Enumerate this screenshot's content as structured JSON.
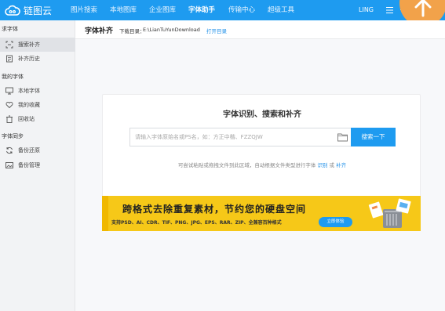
{
  "app": {
    "name": "链图云"
  },
  "nav": {
    "items": [
      {
        "label": "图片搜索"
      },
      {
        "label": "本地图库"
      },
      {
        "label": "企业图库"
      },
      {
        "label": "字体助手"
      },
      {
        "label": "传输中心"
      },
      {
        "label": "超级工具"
      }
    ],
    "active": "字体助手",
    "user": "LING"
  },
  "sidebar": {
    "groups": [
      {
        "title": "求字体",
        "items": [
          {
            "label": "搜索补齐",
            "icon": "scan-icon"
          },
          {
            "label": "补齐历史",
            "icon": "history-icon"
          }
        ]
      },
      {
        "title": "我的字体",
        "items": [
          {
            "label": "本地字体",
            "icon": "monitor-icon"
          },
          {
            "label": "我的收藏",
            "icon": "heart-icon"
          },
          {
            "label": "回收站",
            "icon": "trash-icon"
          }
        ]
      },
      {
        "title": "字体同步",
        "items": [
          {
            "label": "备份还原",
            "icon": "sync-icon"
          },
          {
            "label": "备份管理",
            "icon": "image-icon"
          }
        ]
      }
    ]
  },
  "header": {
    "title": "字体补齐",
    "download_label": "下载目录：",
    "download_path": "E:\\LianTuYunDownload",
    "open_dir": "打开目录"
  },
  "card": {
    "title": "字体识别、搜索和补齐",
    "search_placeholder": "请输入字体原始名或PS名，如：方正中楷、FZZQJW",
    "search_button": "搜索一下",
    "hint_prefix": "可尝试粘贴或拖拽文件到此区域，自动根据文件类型进行字体",
    "hint_link1": "识别",
    "hint_mid": "或",
    "hint_link2": "补齐"
  },
  "banner": {
    "title": "跨格式去除重复素材，节约您的硬盘空间",
    "subtitle": "支持PSD、AI、CDR、TIF、PNG、JPG、EPS、RAR、ZIP、全兼容百种格式",
    "button": "立即体验"
  },
  "colors": {
    "primary": "#1e9bf0",
    "banner": "#f6c818",
    "upload_bubble": "#f2a24a"
  }
}
